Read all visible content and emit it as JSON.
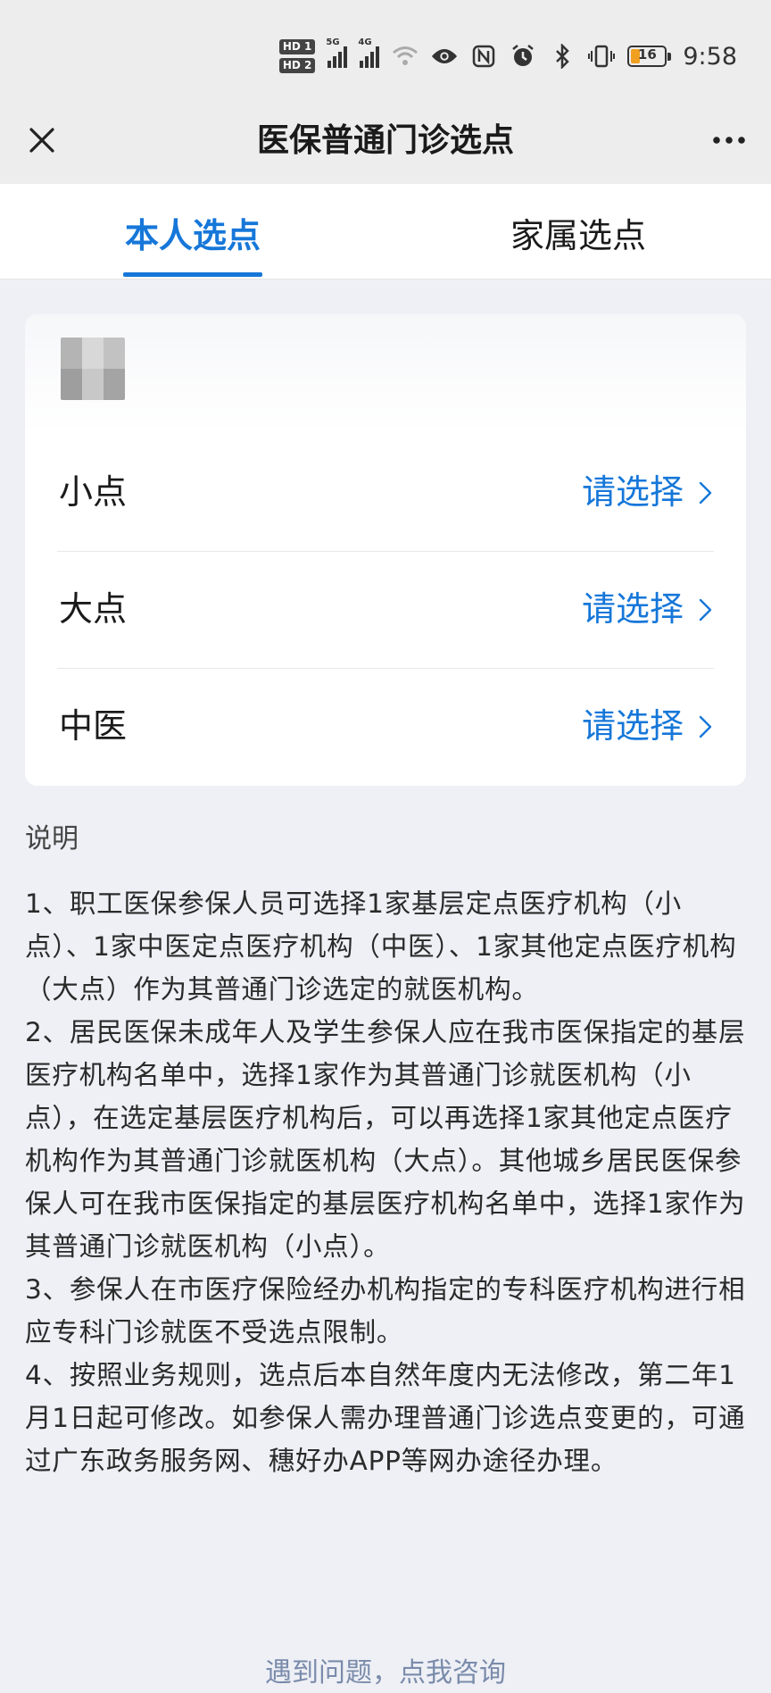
{
  "status": {
    "hd1": "HD 1",
    "hd2": "HD 2",
    "net1": "5G",
    "net2": "4G",
    "battery_level": "16",
    "time": "9:58"
  },
  "nav": {
    "title": "医保普通门诊选点"
  },
  "tabs": {
    "self": "本人选点",
    "family": "家属选点"
  },
  "rows": [
    {
      "label": "小点",
      "value": "请选择"
    },
    {
      "label": "大点",
      "value": "请选择"
    },
    {
      "label": "中医",
      "value": "请选择"
    }
  ],
  "notes": {
    "title": "说明",
    "items": [
      "1、职工医保参保人员可选择1家基层定点医疗机构（小点）、1家中医定点医疗机构（中医）、1家其他定点医疗机构（大点）作为其普通门诊选定的就医机构。",
      "2、居民医保未成年人及学生参保人应在我市医保指定的基层医疗机构名单中，选择1家作为其普通门诊就医机构（小点），在选定基层医疗机构后，可以再选择1家其他定点医疗机构作为其普通门诊就医机构（大点）。其他城乡居民医保参保人可在我市医保指定的基层医疗机构名单中，选择1家作为其普通门诊就医机构（小点）。",
      "3、参保人在市医疗保险经办机构指定的专科医疗机构进行相应专科门诊就医不受选点限制。",
      "4、按照业务规则，选点后本自然年度内无法修改，第二年1月1日起可修改。如参保人需办理普通门诊选点变更的，可通过广东政务服务网、穗好办APP等网办途径办理。"
    ]
  },
  "footer": {
    "link": "遇到问题，点我咨询"
  },
  "colors": {
    "accent": "#1677d9",
    "background": "#eef0f5"
  }
}
